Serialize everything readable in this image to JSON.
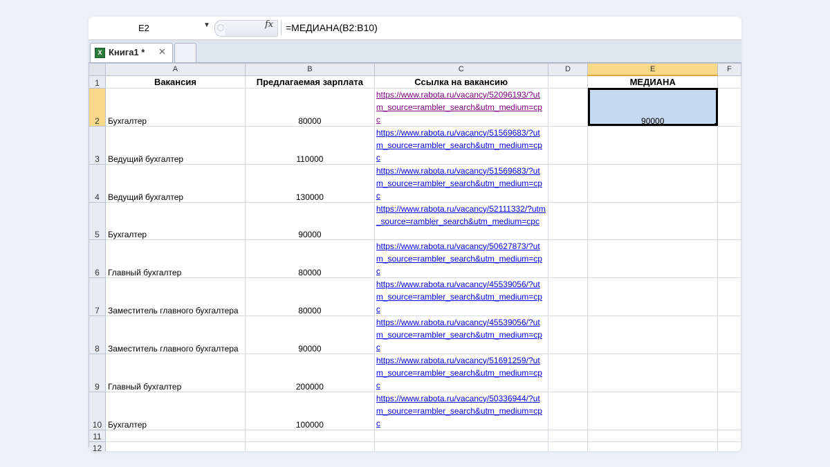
{
  "formula_bar": {
    "name_box": "E2",
    "fx_label": "fx",
    "formula": "=МЕДИАНА(B2:B10)"
  },
  "tab": {
    "title": "Книга1 *",
    "close": "✕",
    "icon_letter": "X"
  },
  "columns": [
    "A",
    "B",
    "C",
    "D",
    "E",
    "F"
  ],
  "header_row": {
    "number": "1",
    "vacancy": "Вакансия",
    "salary": "Предлагаемая зарплата",
    "link": "Ссылка на вакансию",
    "median": "МЕДИАНА"
  },
  "rows": [
    {
      "number": "2",
      "vacancy": "Бухгалтер",
      "salary": "80000",
      "link": "https://www.rabota.ru/vacancy/52096193/?utm_source=rambler_search&utm_medium=cpc"
    },
    {
      "number": "3",
      "vacancy": "Ведущий бухгалтер",
      "salary": "110000",
      "link": "https://www.rabota.ru/vacancy/51569683/?utm_source=rambler_search&utm_medium=cpc"
    },
    {
      "number": "4",
      "vacancy": "Ведущий бухгалтер",
      "salary": "130000",
      "link": "https://www.rabota.ru/vacancy/51569683/?utm_source=rambler_search&utm_medium=cpc"
    },
    {
      "number": "5",
      "vacancy": "Бухгалтер",
      "salary": "90000",
      "link": "https://www.rabota.ru/vacancy/52111332/?utm_source=rambler_search&utm_medium=cpc"
    },
    {
      "number": "6",
      "vacancy": "Главный бухгалтер",
      "salary": "80000",
      "link": "https://www.rabota.ru/vacancy/50627873/?utm_source=rambler_search&utm_medium=cpc"
    },
    {
      "number": "7",
      "vacancy": "Заместитель главного бухгалтера",
      "salary": "80000",
      "link": "https://www.rabota.ru/vacancy/45539056/?utm_source=rambler_search&utm_medium=cpc"
    },
    {
      "number": "8",
      "vacancy": "Заместитель главного бухгалтера",
      "salary": "90000",
      "link": "https://www.rabota.ru/vacancy/45539056/?utm_source=rambler_search&utm_medium=cpc"
    },
    {
      "number": "9",
      "vacancy": "Главный бухгалтер",
      "salary": "200000",
      "link": "https://www.rabota.ru/vacancy/51691259/?utm_source=rambler_search&utm_medium=cpc"
    },
    {
      "number": "10",
      "vacancy": "Бухгалтер",
      "salary": "100000",
      "link": "https://www.rabota.ru/vacancy/50336944/?utm_source=rambler_search&utm_medium=cpc"
    }
  ],
  "median_value": "90000",
  "empty_rows": [
    "11",
    "12"
  ],
  "colors": {
    "selection_fill": "#c5d9f1",
    "selected_header": "#f8d987",
    "link": "#0000ee",
    "visited_link": "#800080"
  }
}
